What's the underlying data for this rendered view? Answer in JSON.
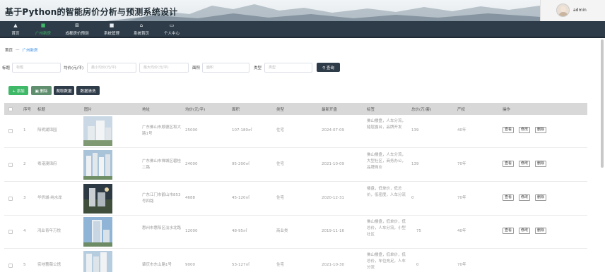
{
  "header": {
    "title": "基于Python的智能房价分析与预测系统设计",
    "username": "admin"
  },
  "nav": [
    {
      "label": "首页",
      "icon": "home-icon",
      "glyph": "▲",
      "active": false
    },
    {
      "label": "广州新房",
      "icon": "building-icon",
      "glyph": "■",
      "active": true
    },
    {
      "label": "成都房价预测",
      "icon": "grid-icon",
      "glyph": "⊞",
      "active": false
    },
    {
      "label": "系统管理",
      "icon": "folder-icon",
      "glyph": "■",
      "active": false
    },
    {
      "label": "系统首页",
      "icon": "house-outline-icon",
      "glyph": "⌂",
      "active": false
    },
    {
      "label": "个人中心",
      "icon": "profile-icon",
      "glyph": "▭",
      "active": false
    }
  ],
  "breadcrumb": {
    "home": "首页",
    "separator": "一",
    "current": "广州新房"
  },
  "search": {
    "title_label": "标题",
    "title_placeholder": "标题",
    "price_label": "均价(元/平)",
    "min_price_placeholder": "最小均价(元/平)",
    "max_price_placeholder": "最大均价(元/平)",
    "area_label": "面积",
    "area_placeholder": "面积",
    "type_label": "类型",
    "type_placeholder": "类型",
    "search_button": "查询"
  },
  "toolbar": {
    "add": "添加",
    "delete": "删除",
    "crawl": "爬取数据",
    "clean": "数据清洗"
  },
  "colors": {
    "nav_bg": "#2e3b48",
    "active": "#3fb868",
    "add_btn": "#3fb868",
    "delete_btn": "#5f8f6e",
    "dark_btn": "#2e3b48"
  },
  "table": {
    "headers": [
      "序号",
      "标题",
      "图片",
      "地址",
      "均价(元/平)",
      "面积",
      "类型",
      "最新开盘",
      "标签",
      "总价(万/套)",
      "产权",
      "操作"
    ],
    "rows": [
      {
        "no": "1",
        "title": "阳明湖锦园",
        "address": "广东佛山市顺德区和大路1号",
        "price": "25000",
        "area": "107-180㎡",
        "type": "住宅",
        "open": "2024-07-09",
        "tags": "佛山楼盘，人车分流，錯层露台，品牌开发",
        "total": "139",
        "term": "40年"
      },
      {
        "no": "2",
        "title": "粤港澳锦府",
        "address": "广东佛山市禅城区碧桂二路",
        "price": "24000",
        "area": "95-200㎡",
        "type": "住宅",
        "open": "2021-10-09",
        "tags": "佛山楼盘，人车分流，大型社区，商务办公，品牌商业",
        "total": "139",
        "term": "70年"
      },
      {
        "no": "3",
        "title": "华侨城·纯水岸",
        "address": "广东江门市鹤山市853号四路",
        "price": "4688",
        "area": "45-120㎡",
        "type": "住宅",
        "open": "2020-12-31",
        "tags": "楼盘，低单价，低总价，低密度，人车分流",
        "total": "0",
        "term": "70年"
      },
      {
        "no": "4",
        "title": "鸿业青年万悦",
        "address": "惠州市惠阳区淡水北路",
        "price": "12000",
        "area": "48-95㎡",
        "type": "商业类",
        "open": "2019-11-16",
        "tags": "佛山楼盘，低单价，低总价，人车分流，小型社区",
        "total": "75",
        "term": "40年"
      },
      {
        "no": "5",
        "title": "实地蔷薇公馆",
        "address": "肇庆市东山路1号",
        "price": "9000",
        "area": "53-127㎡",
        "type": "住宅",
        "open": "2021-10-30",
        "tags": "佛山楼盘，低单价，低总价，车位充足，人车分流",
        "total": "0",
        "term": "70年"
      }
    ],
    "actions": {
      "view": "查看",
      "edit": "修改",
      "delete": "删除"
    }
  }
}
